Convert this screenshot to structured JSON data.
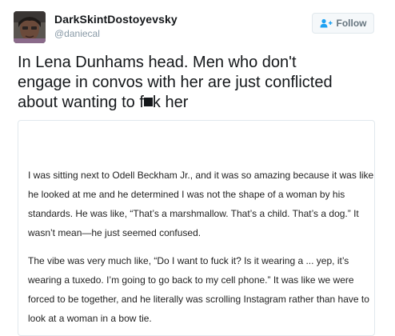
{
  "author": {
    "display_name": "DarkSkintDostoyevsky",
    "handle": "@daniecal"
  },
  "follow_button": {
    "label": "Follow",
    "icon": "add-person-icon",
    "color": "#66757f"
  },
  "tweet": {
    "text_lines": [
      "In Lena Dunhams head. Men who don't",
      "engage in convos with her are just conflicted",
      "about wanting to f"
    ],
    "text_tail": "k her",
    "censor_mark": "black-redaction-block"
  },
  "media": {
    "paragraphs": [
      {
        "lines": [
          "I was sitting next to Odell Beckham Jr., and it was so amazing because it was like",
          "he looked at me and he determined I was not the shape of a woman by his",
          "standards. He was like, “That’s a marshmallow. That’s a child. That’s a dog.” It",
          "wasn’t mean—he just seemed confused."
        ]
      },
      {
        "lines": [
          "The vibe was very much like, “Do I want to fuck it? Is it wearing a ... yep, it’s",
          "wearing a tuxedo. I’m going to go back to my cell phone.” It was like we were",
          "forced to be together, and he literally was scrolling Instagram rather than have to",
          "look at a woman in a bow tie."
        ]
      }
    ]
  },
  "colors": {
    "text": "#14171a",
    "secondary": "#8899a6",
    "border": "#e1e8ed"
  }
}
